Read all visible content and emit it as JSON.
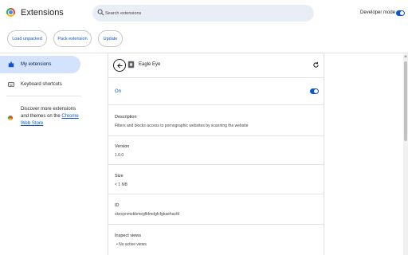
{
  "header": {
    "title": "Extensions",
    "search_placeholder": "Search extensions",
    "developer_mode_label": "Developer mode",
    "developer_mode_on": true
  },
  "toolbar": {
    "load_unpacked": "Load unpacked",
    "pack_extension": "Pack extension",
    "update": "Update"
  },
  "sidebar": {
    "items": [
      {
        "label": "My extensions",
        "icon": "puzzle-icon",
        "active": true
      },
      {
        "label": "Keyboard shortcuts",
        "icon": "keyboard-icon",
        "active": false
      }
    ],
    "store_text": "Discover more extensions and themes on the ",
    "store_link": "Chrome Web Store"
  },
  "detail": {
    "name": "Eagle Eye",
    "status": "On",
    "enabled": true,
    "description_label": "Description",
    "description": "Filters and blocks access to pornographic websites by scanning the website",
    "version_label": "Version",
    "version": "1.0.0",
    "size_label": "Size",
    "size": "< 1 MB",
    "id_label": "ID",
    "id": "ckecpnmekbmegfkfmdgfcfgkaehacfd",
    "inspect_label": "Inspect views",
    "inspect_value": "No active views"
  },
  "colors": {
    "accent": "#0b57d0",
    "active_nav": "#d3e3fd",
    "search_bg": "#e9eef6"
  }
}
